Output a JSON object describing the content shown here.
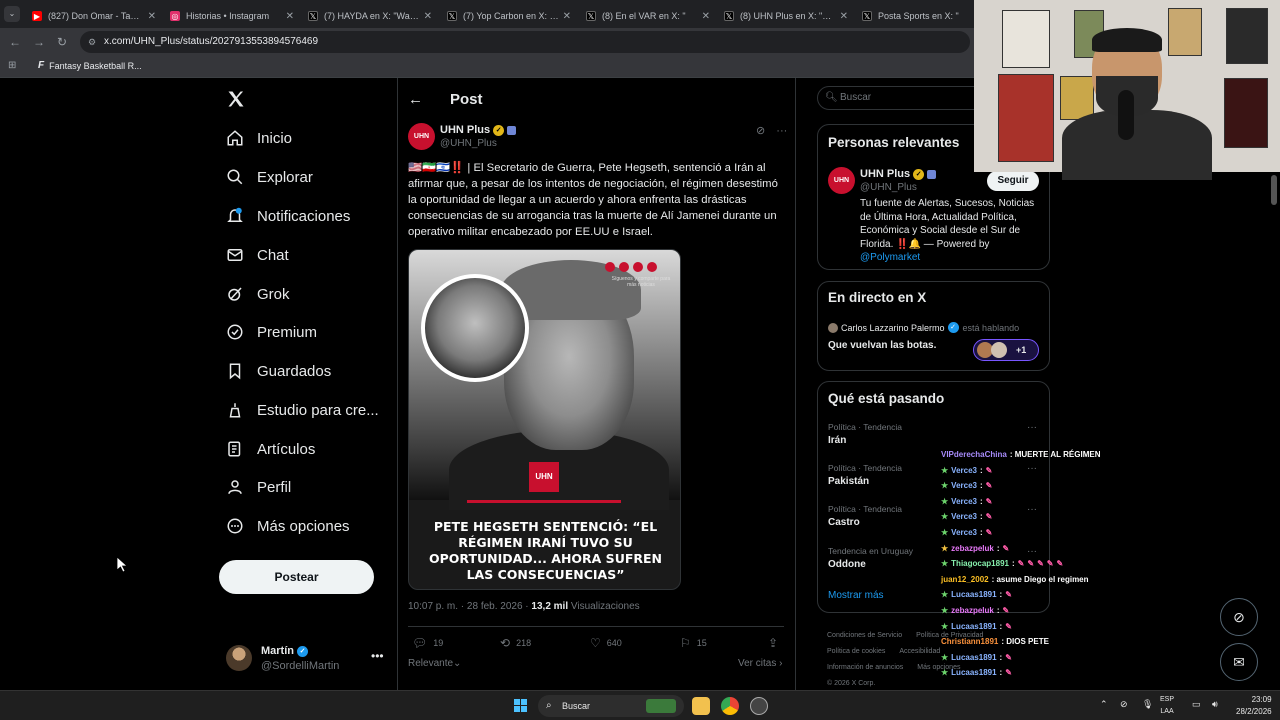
{
  "browser": {
    "tabs": [
      {
        "title": "(827) Don Omar - Taboo",
        "icon": "youtube-icon",
        "color": "#ff0000"
      },
      {
        "title": "Historias • Instagram",
        "icon": "instagram-icon",
        "color": "#e1306c"
      },
      {
        "title": "(7) HAYDA en X: \"Wanda",
        "icon": "x-icon",
        "color": "#000000"
      },
      {
        "title": "(7) Yop Carbon en X: \"TR",
        "icon": "x-icon",
        "color": "#000000"
      },
      {
        "title": "(8) En el VAR en X: \"",
        "icon": "x-icon",
        "color": "#000000"
      },
      {
        "title": "(8) UHN Plus en X: \"usua",
        "icon": "x-icon",
        "color": "#000000"
      },
      {
        "title": "Posta Sports en X: \"",
        "icon": "x-icon",
        "color": "#000000"
      }
    ],
    "url": "x.com/UHN_Plus/status/2027913553894576469",
    "bookmark": "Fantasy Basketball R..."
  },
  "sidebar": {
    "items": [
      {
        "label": "Inicio",
        "icon": "home-icon"
      },
      {
        "label": "Explorar",
        "icon": "search-icon"
      },
      {
        "label": "Notificaciones",
        "icon": "bell-icon"
      },
      {
        "label": "Chat",
        "icon": "mail-icon"
      },
      {
        "label": "Grok",
        "icon": "grok-icon"
      },
      {
        "label": "Premium",
        "icon": "premium-icon"
      },
      {
        "label": "Guardados",
        "icon": "bookmark-icon"
      },
      {
        "label": "Estudio para cre...",
        "icon": "creator-studio-icon"
      },
      {
        "label": "Artículos",
        "icon": "articles-icon"
      },
      {
        "label": "Perfil",
        "icon": "person-icon"
      },
      {
        "label": "Más opciones",
        "icon": "more-options-icon"
      }
    ],
    "post_button": "Postear",
    "account": {
      "name": "Martín",
      "handle": "@SordelliMartin"
    }
  },
  "post": {
    "header": "Post",
    "author": {
      "name": "UHN Plus",
      "handle": "@UHN_Plus",
      "avatar_text": "UHN"
    },
    "text": "🇺🇸🇮🇷🇮🇱‼️ | El Secretario de Guerra, Pete Hegseth, sentenció a Irán al afirmar que, a pesar de los intentos de negociación, el régimen desestimó la oportunidad de llegar a un acuerdo y ahora enfrenta las drásticas consecuencias de su arrogancia tras la muerte de Alí Jamenei durante un operativo militar encabezado por EE.UU e Israel.",
    "image": {
      "headline": "PETE HEGSETH SENTENCIÓ: “EL RÉGIMEN IRANÍ TUVO SU OPORTUNIDAD... AHORA SUFREN LAS CONSECUENCIAS”",
      "logo": "UHN",
      "social_caption": "Síguenos y comparte para más noticias"
    },
    "time": "10:07 p. m. · 28 feb. 2026 · ",
    "views_count": "13,2 mil",
    "views_label": " Visualizaciones",
    "actions": {
      "replies": "19",
      "reposts": "218",
      "likes": "640",
      "bookmarks": "15"
    },
    "sort": "Relevante",
    "quotes": "Ver citas"
  },
  "right": {
    "search_placeholder": "Buscar",
    "relevant": {
      "title": "Personas relevantes",
      "name": "UHN Plus",
      "handle": "@UHN_Plus",
      "follow": "Seguir",
      "bio": "Tu fuente de Alertas, Sucesos, Noticias de Última Hora, Actualidad Política, Económica y Social desde el Sur de Florida. ‼️🔔 — Powered by ",
      "bio_link": "@Polymarket"
    },
    "live": {
      "title": "En directo en X",
      "host": "Carlos Lazzarino Palermo",
      "status": "está hablando",
      "space_title": "Que vuelvan las botas.",
      "listeners_extra": "+1"
    },
    "trends": {
      "title": "Qué está pasando",
      "items": [
        {
          "category": "Política · Tendencia",
          "name": "Irán"
        },
        {
          "category": "Política · Tendencia",
          "name": "Pakistán"
        },
        {
          "category": "Política · Tendencia",
          "name": "Castro"
        },
        {
          "category": "Tendencia en Uruguay",
          "name": "Oddone"
        }
      ],
      "show_more": "Mostrar más"
    },
    "footer": [
      "Condiciones de Servicio",
      "Política de Privacidad",
      "Política de cookies",
      "Accesibilidad",
      "Información de anuncios",
      "Más opciones",
      "© 2026 X Corp."
    ]
  },
  "chat": [
    {
      "user": "VIPderechaChina",
      "msg": ": MUERTE AL RÉGIMEN",
      "user_color": "#a78bfa",
      "star": false
    },
    {
      "user": "Verce3",
      "msg": ":",
      "user_color": "#8ab4ff",
      "star": true
    },
    {
      "user": "Verce3",
      "msg": ":",
      "user_color": "#8ab4ff",
      "star": true
    },
    {
      "user": "Verce3",
      "msg": ":",
      "user_color": "#8ab4ff",
      "star": true
    },
    {
      "user": "Verce3",
      "msg": ":",
      "user_color": "#8ab4ff",
      "star": true
    },
    {
      "user": "Verce3",
      "msg": ":",
      "user_color": "#8ab4ff",
      "star": true
    },
    {
      "user": "zebazpeluk",
      "msg": ":",
      "user_color": "#e879f9",
      "star": true
    },
    {
      "user": "Thiagocap1891",
      "msg": ":",
      "user_color": "#86efac",
      "star": true
    },
    {
      "user": "juan12_2002",
      "msg": ": asume Diego el regimen",
      "user_color": "#fbbf24",
      "star": false
    },
    {
      "user": "Lucaas1891",
      "msg": ":",
      "user_color": "#8ab4ff",
      "star": true
    },
    {
      "user": "zebazpeluk",
      "msg": ":",
      "user_color": "#e879f9",
      "star": true
    },
    {
      "user": "Lucaas1891",
      "msg": ":",
      "user_color": "#8ab4ff",
      "star": true
    },
    {
      "user": "Christiann1891",
      "msg": ": DIOS PETE",
      "user_color": "#fb923c",
      "star": false
    },
    {
      "user": "Lucaas1891",
      "msg": ":",
      "user_color": "#8ab4ff",
      "star": true
    },
    {
      "user": "Lucaas1891",
      "msg": ":",
      "user_color": "#8ab4ff",
      "star": true
    }
  ],
  "taskbar": {
    "search": "Buscar",
    "lang": "ESP",
    "lang_sub": "LAA",
    "time": "23:09",
    "date": "28/2/2026"
  },
  "colors": {
    "accent": "#1d9bf0",
    "brand": "#c8102e",
    "bg": "#000000"
  }
}
